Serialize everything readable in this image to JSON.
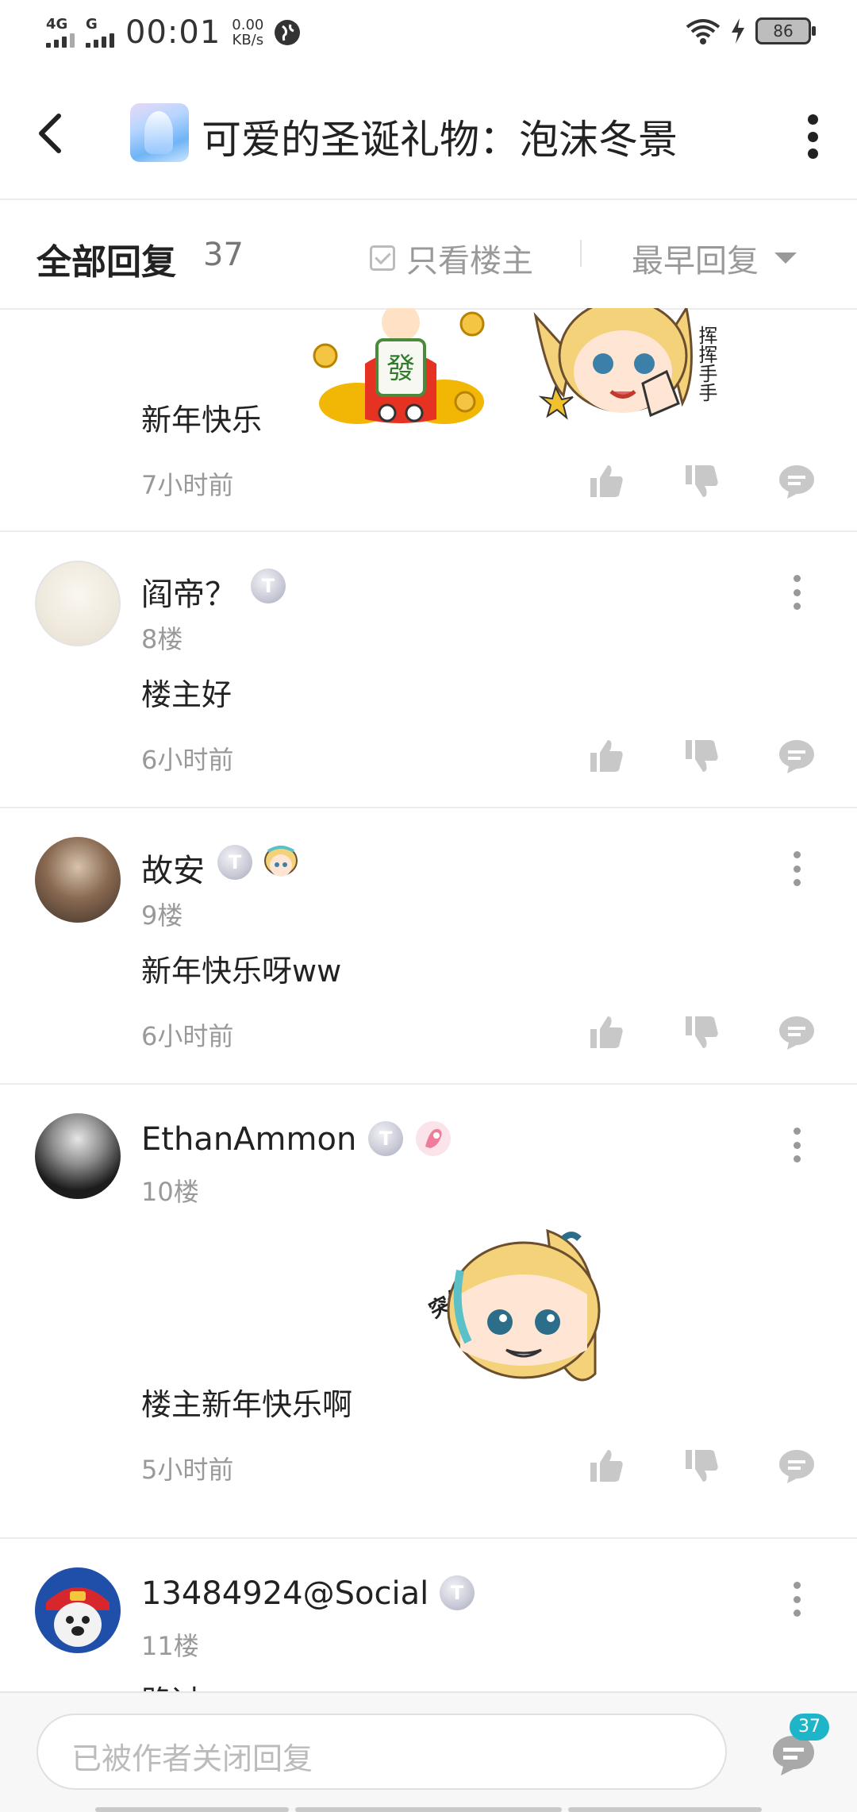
{
  "status_bar": {
    "net1": "4G",
    "net2": "G",
    "time": "00:01",
    "speed_value": "0.00",
    "speed_unit": "KB/s",
    "battery": "86"
  },
  "header": {
    "title": "可爱的圣诞礼物：泡沫冬景",
    "back_icon": "back-arrow-icon",
    "more_icon": "more-vertical-icon"
  },
  "filter": {
    "all_replies_label": "全部回复",
    "reply_count": "37",
    "owner_only_label": "只看楼主",
    "sort_label": "最早回复"
  },
  "posts": [
    {
      "content": "新年快乐",
      "time": "7小时前"
    },
    {
      "username": "阎帝？",
      "badge": "T",
      "floor": "8楼",
      "content": "楼主好",
      "time": "6小时前"
    },
    {
      "username": "故安",
      "badge": "T",
      "floor": "9楼",
      "content": "新年快乐呀ww",
      "time": "6小时前"
    },
    {
      "username": "EthanAmmon",
      "badge": "T",
      "floor": "10楼",
      "content": "楼主新年快乐啊",
      "time": "5小时前",
      "sticker_text": "突然出现!"
    },
    {
      "username": "13484924@Social",
      "badge": "T",
      "floor": "11楼",
      "content": "路过"
    }
  ],
  "sticker_texts": {
    "mahjong": "發",
    "wave": "挥挥手手"
  },
  "bottom": {
    "input_placeholder": "已被作者关闭回复",
    "comment_count": "37"
  }
}
